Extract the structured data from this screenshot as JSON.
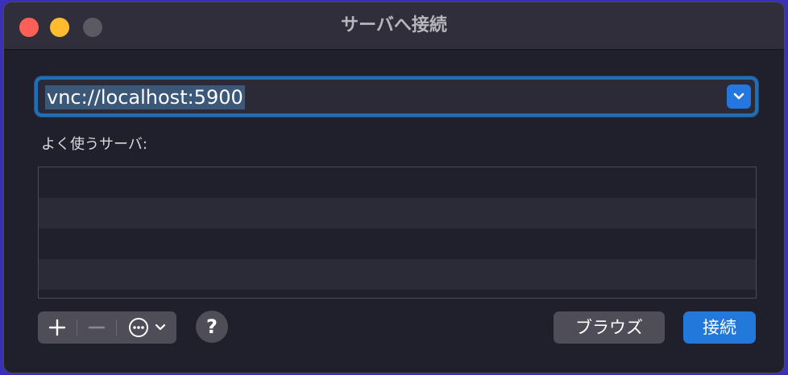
{
  "window": {
    "title": "サーバへ接続"
  },
  "url_field": {
    "value": "vnc://localhost:5900"
  },
  "favorites": {
    "label": "よく使うサーバ:",
    "rows": [
      "",
      "",
      "",
      ""
    ]
  },
  "toolbar": {
    "add_icon": "plus-icon",
    "remove_icon": "minus-icon",
    "action_icon": "ellipsis-circle-icon",
    "help_label": "?",
    "browse_label": "ブラウズ",
    "connect_label": "接続"
  },
  "colors": {
    "accent": "#2378dc",
    "close": "#fe5f57",
    "minimize": "#febc2e",
    "zoom_inactive": "#5b5a63"
  }
}
